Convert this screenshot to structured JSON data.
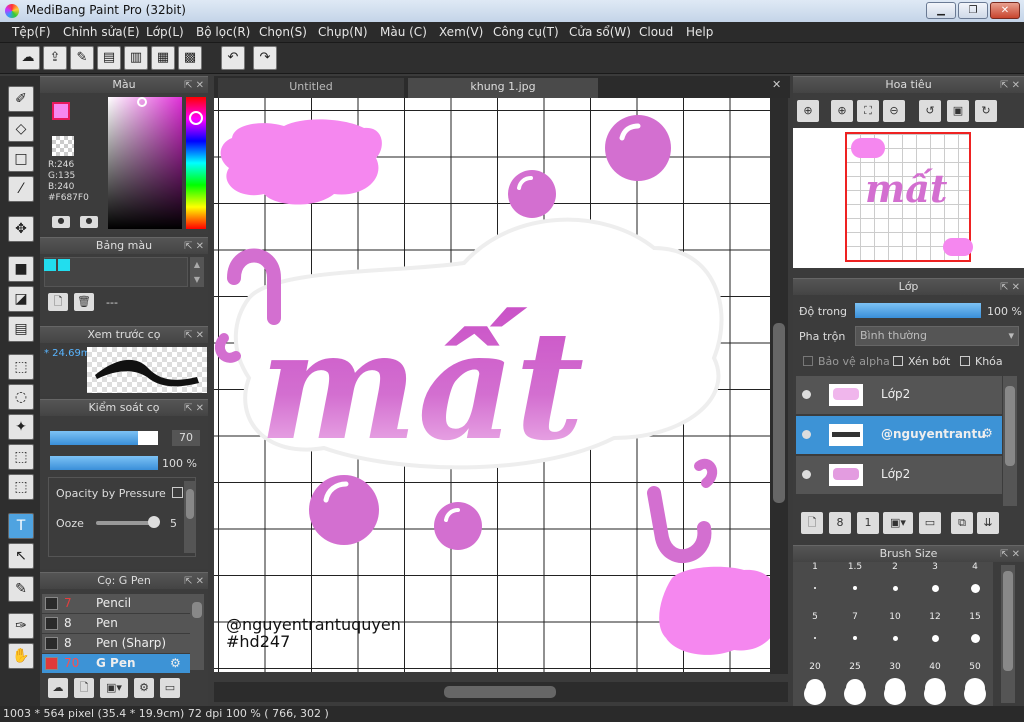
{
  "window": {
    "title": "MediBang Paint Pro (32bit)",
    "min_glyph": "▁",
    "max_glyph": "❐",
    "close_glyph": "✕"
  },
  "menu": [
    "Tệp(F)",
    "Chỉnh sửa(E)",
    "Lớp(L)",
    "Bộ lọc(R)",
    "Chọn(S)",
    "Chụp(N)",
    "Màu (C)",
    "Xem(V)",
    "Công cụ(T)",
    "Cửa sổ(W)",
    "Cloud",
    "Help"
  ],
  "toolbar_icons": [
    "cloud-icon",
    "share-icon",
    "comment-icon",
    "chat-icon",
    "document-icon",
    "panel-layout-icon",
    "grid-layout-icon",
    "undo-icon",
    "redo-icon"
  ],
  "tabs": [
    "Untitled",
    "khung 1.jpg"
  ],
  "color_panel": {
    "title": "Màu",
    "rgb_r": "R:246",
    "rgb_g": "G:135",
    "rgb_b": "B:240",
    "hex": "#F687F0",
    "primary": "#f687f0",
    "secondary": "#ffffff"
  },
  "palette_panel": {
    "title": "Bảng màu",
    "swatches": [
      "#22ddee",
      "#22ddee"
    ],
    "label": "---"
  },
  "brush_preview_panel": {
    "title": "Xem trước cọ",
    "size": "* 24.69m"
  },
  "brush_control_panel": {
    "title": "Kiểm soát cọ",
    "size_value": "70",
    "opacity_value": "100 %",
    "opacity_by_pressure": "Opacity by Pressure",
    "ooze_label": "Ooze",
    "ooze_value": "5"
  },
  "brush_list_panel": {
    "title": "Cọ: G Pen",
    "items": [
      {
        "size": "7",
        "name": "Pencil",
        "color": "#2a2a2a",
        "selected": false
      },
      {
        "size": "8",
        "name": "Pen",
        "color": "#2a2a2a",
        "selected": false
      },
      {
        "size": "8",
        "name": "Pen (Sharp)",
        "color": "#2a2a2a",
        "selected": false
      },
      {
        "size": "70",
        "name": "G Pen",
        "color": "#e03a3a",
        "selected": true
      }
    ]
  },
  "navigator": {
    "title": "Hoa tiêu"
  },
  "layer_panel": {
    "title": "Lớp",
    "opacity_label": "Độ trong",
    "opacity_value": "100 %",
    "blend_label": "Pha trộn",
    "blend_value": "Bình thường",
    "protect_alpha": "Bảo vệ alpha",
    "clipping": "Xén bớt",
    "lock": "Khóa",
    "layers": [
      {
        "name": "Lớp2",
        "selected": false
      },
      {
        "name": "@nguyentrantu",
        "selected": true
      },
      {
        "name": "Lớp2",
        "selected": false
      }
    ]
  },
  "brush_size_panel": {
    "title": "Brush Size",
    "sizes": [
      "1",
      "1.5",
      "2",
      "3",
      "4",
      "5",
      "7",
      "10",
      "12",
      "15",
      "20",
      "25",
      "30",
      "40",
      "50"
    ]
  },
  "canvas": {
    "main_word": "mất",
    "watermark_line1": "@nguyentrantuquyen",
    "watermark_line2": "#hd247",
    "accent": "#d36fd0"
  },
  "status": {
    "text": "1003 * 564 pixel   (35.4 * 19.9cm)   72 dpi   100 %   ( 766, 302 )"
  }
}
